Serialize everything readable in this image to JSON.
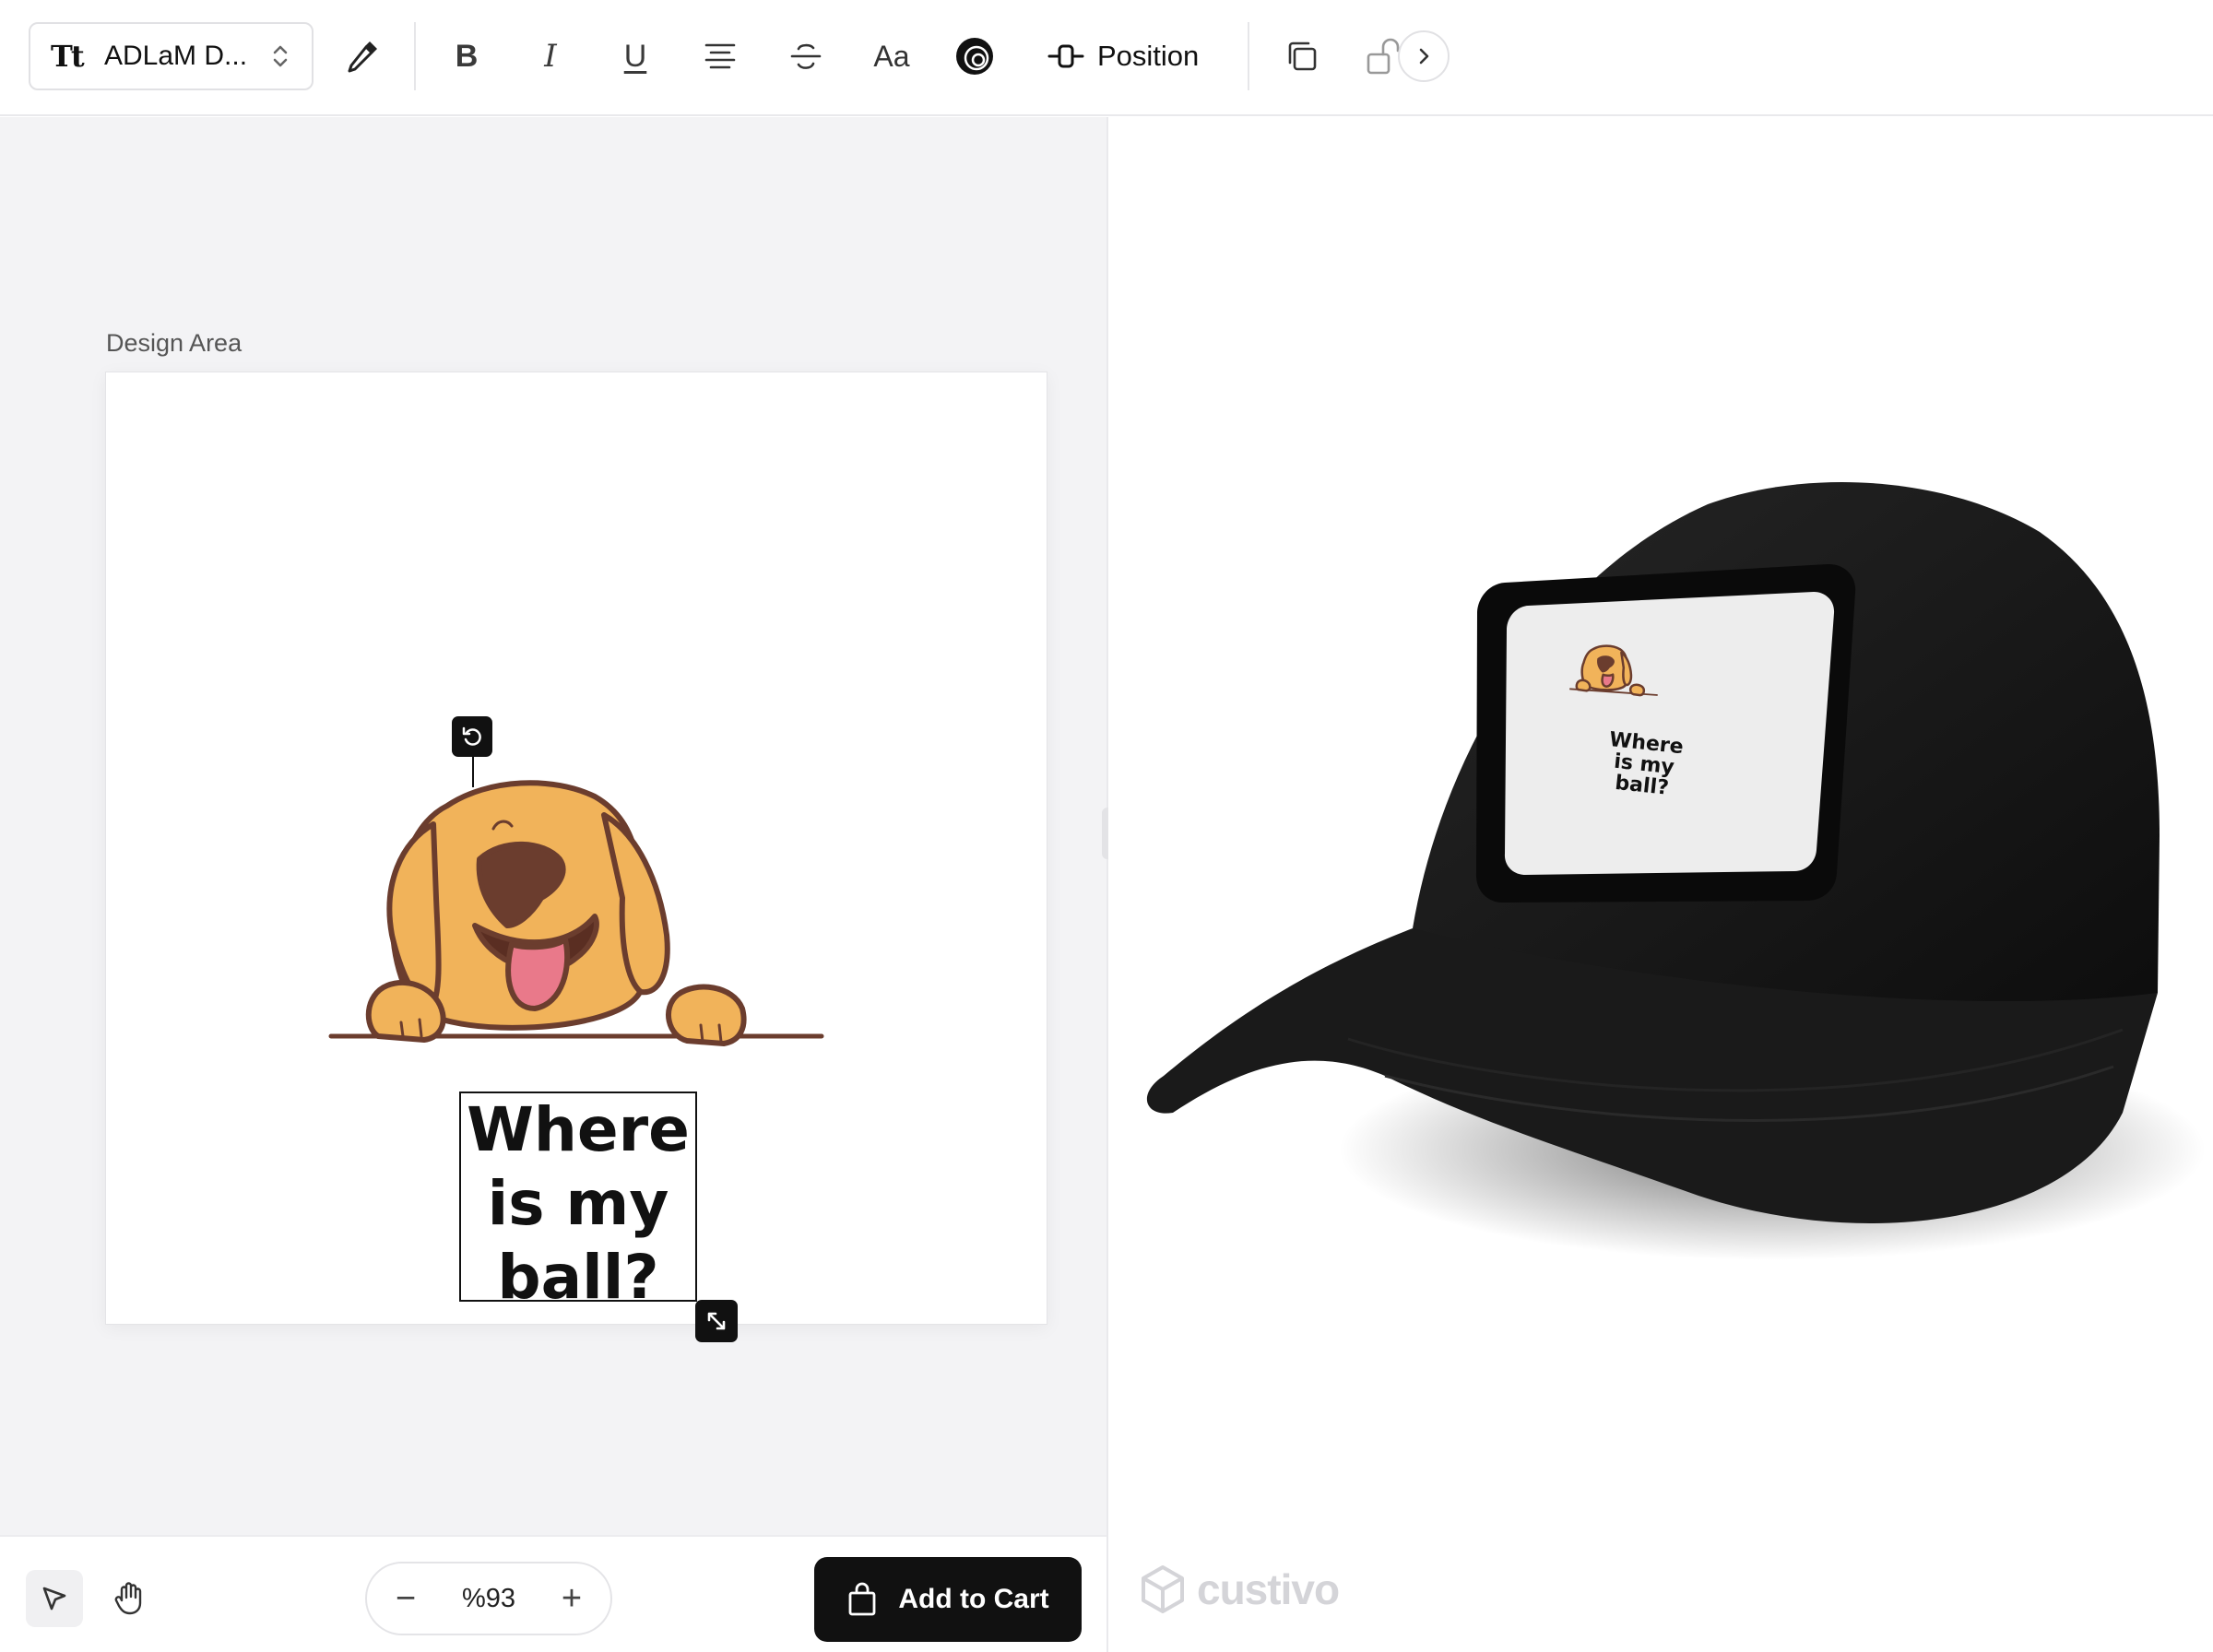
{
  "toolbar": {
    "font_icon": "Tt",
    "font_name": "ADLaM D...",
    "icons": [
      "eyedropper-icon",
      "bold-icon",
      "italic-icon",
      "underline-icon",
      "align-center-icon",
      "strikethrough-icon",
      "text-case-icon",
      "spiral-effect-icon",
      "duplicate-icon",
      "lock-icon",
      "chevron-right-icon"
    ],
    "bold_label": "B",
    "italic_label": "I",
    "underline_label": "U",
    "case_label": "Aa",
    "position_label": "Position"
  },
  "editor": {
    "design_area_label": "Design Area",
    "design_text": "Where\nis my\nball?"
  },
  "bottom": {
    "zoom_minus": "−",
    "zoom_value": "%93",
    "zoom_plus": "+",
    "add_to_cart_label": "Add to Cart"
  },
  "preview": {
    "patch_text": "Where\nis my\nball?",
    "brand": "custivo",
    "cap_color": "#151515",
    "patch_color": "#ededed"
  },
  "colors": {
    "dog_fur": "#f1b35a",
    "dog_outline": "#6b3d2e",
    "tongue": "#e9798a",
    "accent": "#111111"
  }
}
